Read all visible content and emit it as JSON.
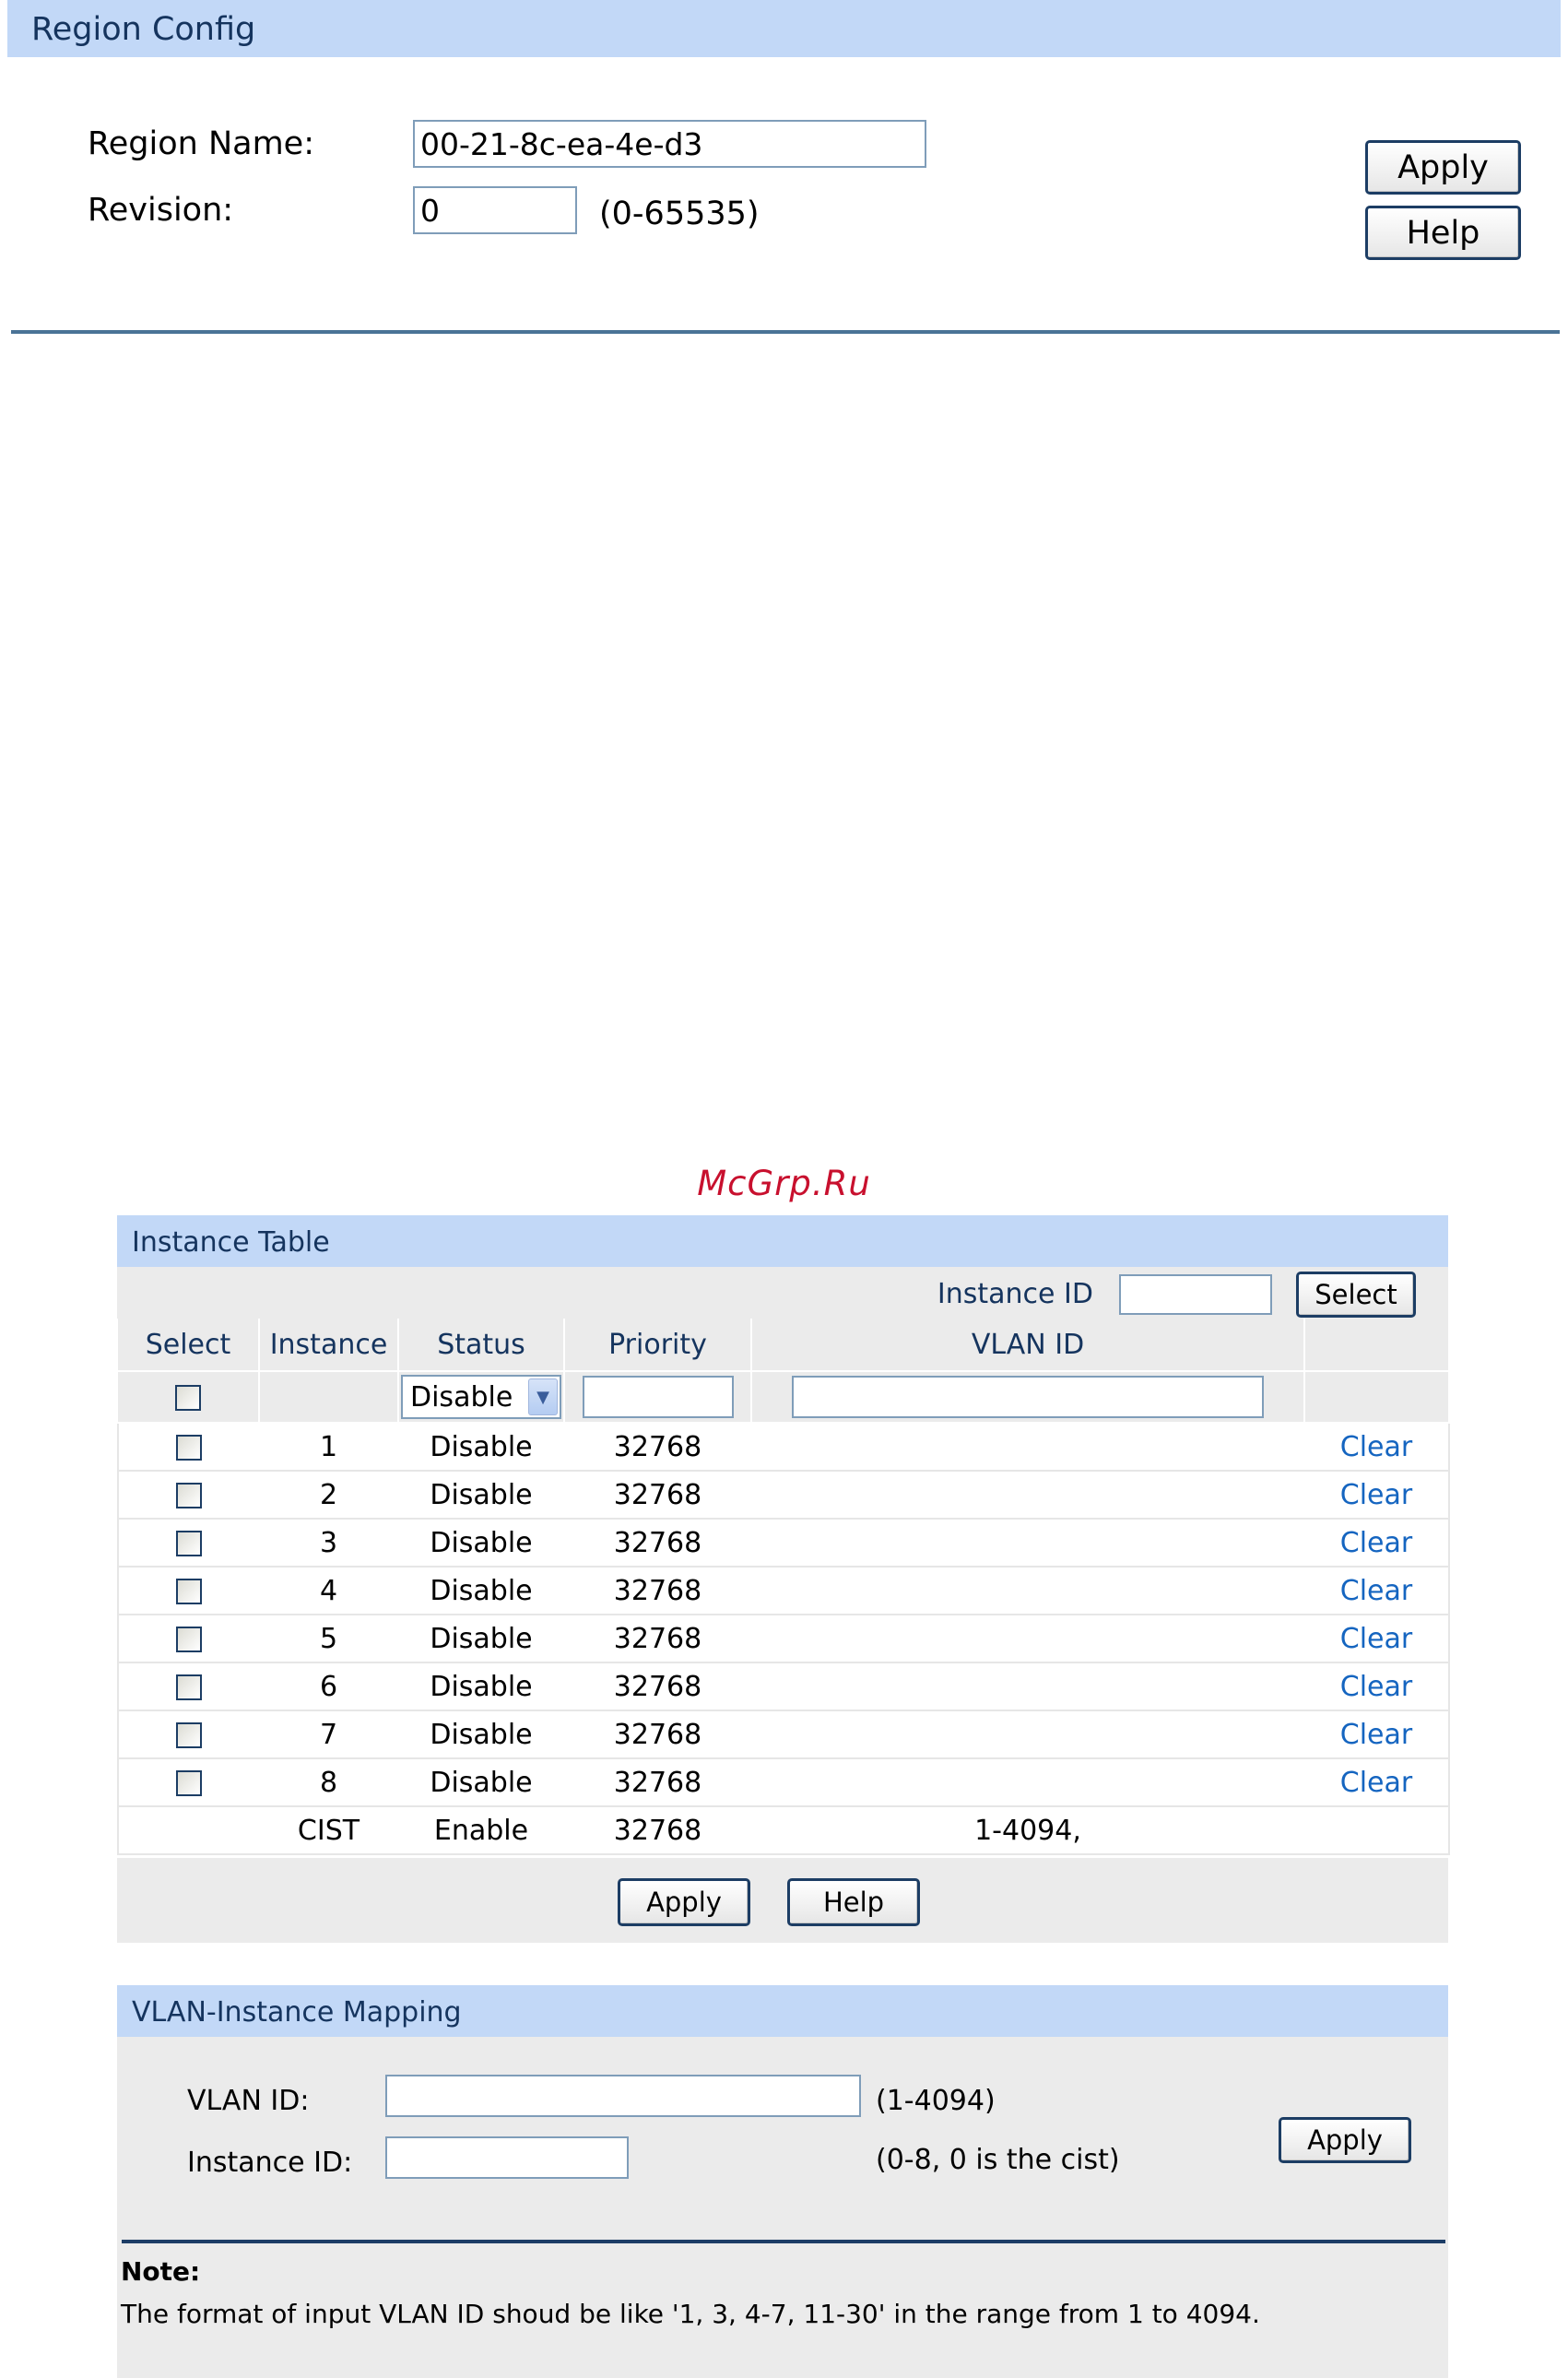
{
  "region_config": {
    "title": "Region Config",
    "region_name_label": "Region Name:",
    "region_name_value": "00-21-8c-ea-4e-d3",
    "revision_label": "Revision:",
    "revision_value": "0",
    "revision_hint": "(0-65535)",
    "apply_label": "Apply",
    "help_label": "Help"
  },
  "watermark": "McGrp.Ru",
  "instance_table": {
    "title": "Instance Table",
    "instance_id_label": "Instance ID",
    "instance_id_value": "",
    "select_button": "Select",
    "columns": [
      "Select",
      "Instance",
      "Status",
      "Priority",
      "VLAN ID"
    ],
    "edit_row": {
      "status": "Disable",
      "priority": "",
      "vlan_id": ""
    },
    "rows": [
      {
        "instance": "1",
        "status": "Disable",
        "priority": "32768",
        "vlan_id": "",
        "action": "Clear"
      },
      {
        "instance": "2",
        "status": "Disable",
        "priority": "32768",
        "vlan_id": "",
        "action": "Clear"
      },
      {
        "instance": "3",
        "status": "Disable",
        "priority": "32768",
        "vlan_id": "",
        "action": "Clear"
      },
      {
        "instance": "4",
        "status": "Disable",
        "priority": "32768",
        "vlan_id": "",
        "action": "Clear"
      },
      {
        "instance": "5",
        "status": "Disable",
        "priority": "32768",
        "vlan_id": "",
        "action": "Clear"
      },
      {
        "instance": "6",
        "status": "Disable",
        "priority": "32768",
        "vlan_id": "",
        "action": "Clear"
      },
      {
        "instance": "7",
        "status": "Disable",
        "priority": "32768",
        "vlan_id": "",
        "action": "Clear"
      },
      {
        "instance": "8",
        "status": "Disable",
        "priority": "32768",
        "vlan_id": "",
        "action": "Clear"
      }
    ],
    "cist_row": {
      "instance": "CIST",
      "status": "Enable",
      "priority": "32768",
      "vlan_id": "1-4094,"
    },
    "apply_label": "Apply",
    "help_label": "Help"
  },
  "vlan_mapping": {
    "title": "VLAN-Instance Mapping",
    "vlan_id_label": "VLAN ID:",
    "vlan_id_value": "",
    "vlan_id_hint": "(1-4094)",
    "instance_id_label": "Instance ID:",
    "instance_id_value": "",
    "instance_id_hint": "(0-8, 0 is the cist)",
    "apply_label": "Apply"
  },
  "note": {
    "title": "Note:",
    "text": "The format of input VLAN ID shoud be like '1, 3, 4-7, 11-30' in the range from 1 to 4094."
  }
}
